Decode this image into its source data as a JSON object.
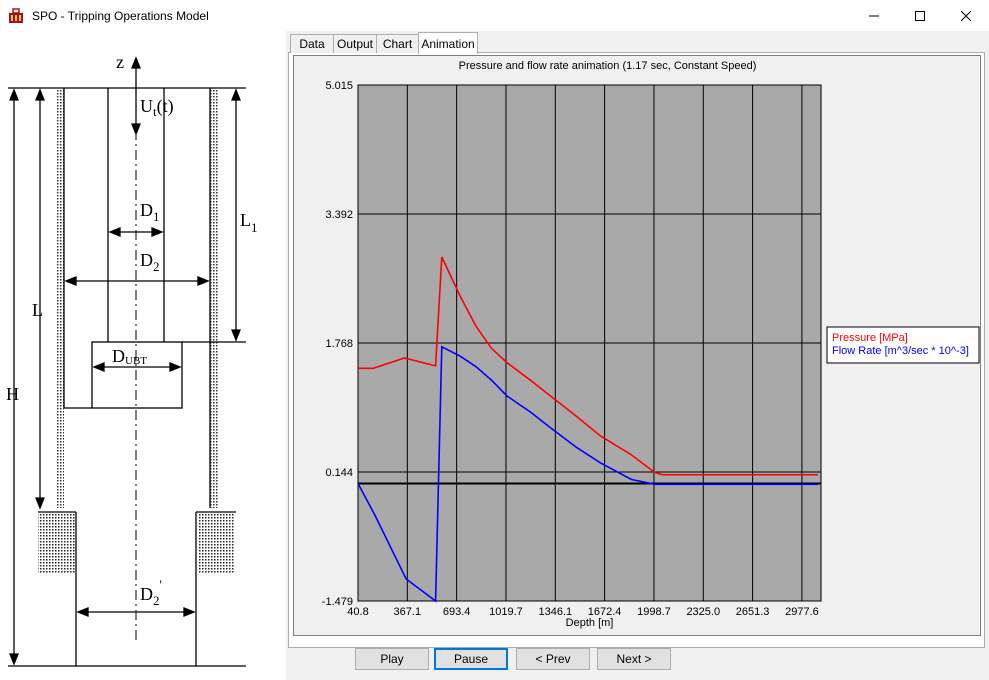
{
  "window": {
    "title": "SPO - Tripping Operations Model",
    "minimize_icon": "minimize-icon",
    "maximize_icon": "maximize-icon",
    "close_icon": "close-icon"
  },
  "schematic": {
    "labels": {
      "z": "z",
      "ut": "U",
      "ut_sub": "t",
      "ut_arg": "(t)",
      "d1": "D",
      "d1_sub": "1",
      "d2": "D",
      "d2_sub": "2",
      "l1": "L",
      "l1_sub": "1",
      "l": "L",
      "h": "H",
      "dubt": "D",
      "dubt_sub": "UBT",
      "d2p": "D",
      "d2p_sub": "2",
      "d2p_prime": "'"
    }
  },
  "tabs": [
    {
      "label": "Data",
      "active": false
    },
    {
      "label": "Output",
      "active": false
    },
    {
      "label": "Chart",
      "active": false
    },
    {
      "label": "Animation",
      "active": true
    }
  ],
  "controls": {
    "play": "Play",
    "pause": "Pause",
    "prev": "< Prev",
    "next": "Next >"
  },
  "chart_data": {
    "type": "line",
    "title": "Pressure and flow rate animation (1.17 sec,  Constant Speed)",
    "xlabel": "Depth [m]",
    "ylabel": "",
    "x_ticks": [
      "40.8",
      "367.1",
      "693.4",
      "1019.7",
      "1346.1",
      "1672.4",
      "1998.7",
      "2325.0",
      "2651.3",
      "2977.6"
    ],
    "y_ticks": [
      "5.015",
      "3.392",
      "1.768",
      "0.144",
      "-1.479"
    ],
    "xlim": [
      40.8,
      3020
    ],
    "ylim": [
      -1.479,
      5.015
    ],
    "grid": true,
    "legend_position": "right",
    "plot_background": "#a9a9a9",
    "zero_line": 0.0,
    "series": [
      {
        "name": "Pressure [MPa]",
        "color": "#ff0000",
        "x": [
          40.8,
          140,
          340,
          540,
          580,
          700,
          800,
          900,
          1000,
          1150,
          1300,
          1450,
          1600,
          1800,
          1950,
          2000,
          2300,
          2600,
          3000
        ],
        "y": [
          1.45,
          1.45,
          1.58,
          1.48,
          2.85,
          2.35,
          1.98,
          1.7,
          1.52,
          1.3,
          1.07,
          0.84,
          0.6,
          0.36,
          0.14,
          0.11,
          0.11,
          0.11,
          0.11
        ]
      },
      {
        "name": "Flow Rate [m^3/sec * 10^-3]",
        "color": "#0000ff",
        "x": [
          40.8,
          150,
          350,
          540,
          580,
          700,
          800,
          900,
          1000,
          1150,
          1300,
          1450,
          1600,
          1800,
          1950,
          2000,
          2300,
          2600,
          3000
        ],
        "y": [
          0.0,
          -0.4,
          -1.2,
          -1.479,
          1.72,
          1.6,
          1.47,
          1.3,
          1.1,
          0.9,
          0.67,
          0.45,
          0.26,
          0.05,
          -0.01,
          -0.01,
          -0.01,
          -0.01,
          -0.01
        ]
      }
    ]
  }
}
